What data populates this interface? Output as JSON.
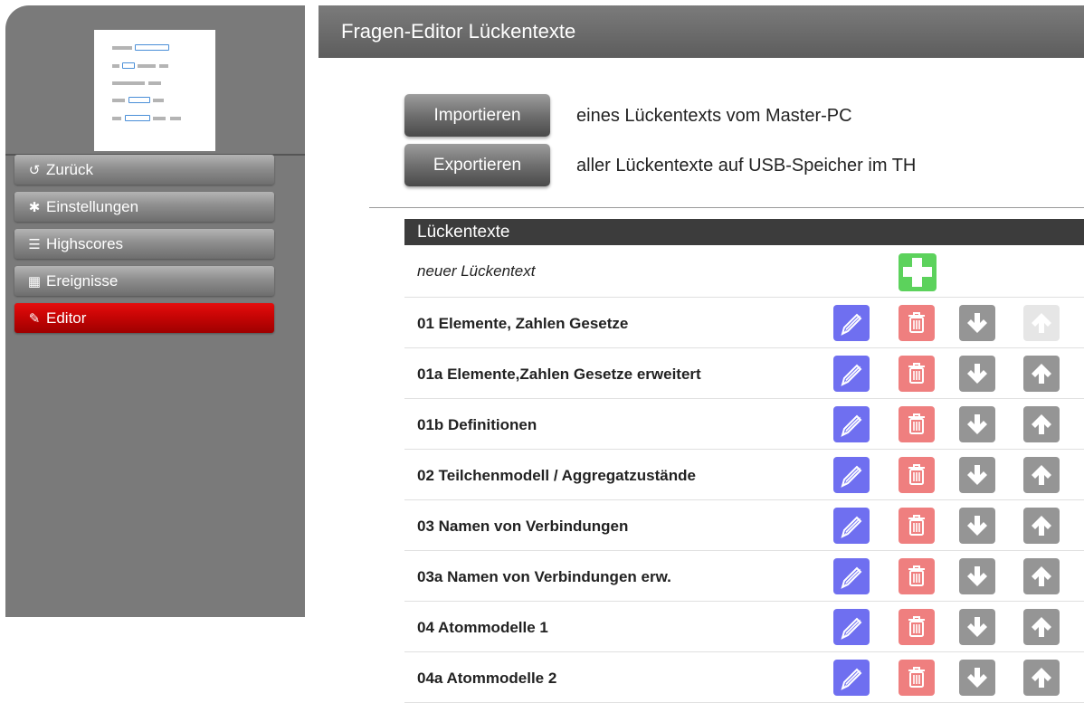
{
  "sidebar": {
    "logo_icon": "gap-text-logo-icon",
    "items": [
      {
        "label": "Zurück",
        "icon": "undo-arrow-icon",
        "active": false
      },
      {
        "label": "Einstellungen",
        "icon": "gear-icon",
        "active": false
      },
      {
        "label": "Highscores",
        "icon": "list-icon",
        "active": false
      },
      {
        "label": "Ereignisse",
        "icon": "calendar-icon",
        "active": false
      },
      {
        "label": "Editor",
        "icon": "edit-icon",
        "active": true
      }
    ]
  },
  "header": {
    "title": "Fragen-Editor Lückentexte"
  },
  "actions": {
    "import_label": "Importieren",
    "import_desc": "eines Lückentexts vom Master-PC",
    "export_label": "Exportieren",
    "export_desc": "aller Lückentexte auf USB-Speicher im TH"
  },
  "table": {
    "header": "Lückentexte",
    "new_label": "neuer Lückentext",
    "rows": [
      {
        "title": "01 Elemente, Zahlen Gesetze",
        "up_disabled": true
      },
      {
        "title": "01a Elemente,Zahlen Gesetze erweitert",
        "up_disabled": false
      },
      {
        "title": "01b Definitionen",
        "up_disabled": false
      },
      {
        "title": "02 Teilchenmodell / Aggregatzustände",
        "up_disabled": false
      },
      {
        "title": "03 Namen von Verbindungen",
        "up_disabled": false
      },
      {
        "title": "03a Namen von Verbindungen erw.",
        "up_disabled": false
      },
      {
        "title": "04 Atommodelle 1",
        "up_disabled": false
      },
      {
        "title": "04a Atommodelle 2",
        "up_disabled": false
      }
    ]
  },
  "colors": {
    "active_nav": "#c30404",
    "edit_button": "#6f6ff0",
    "delete_button": "#ef7f7f",
    "add_button": "#5cd25c",
    "move_button": "#959595"
  }
}
